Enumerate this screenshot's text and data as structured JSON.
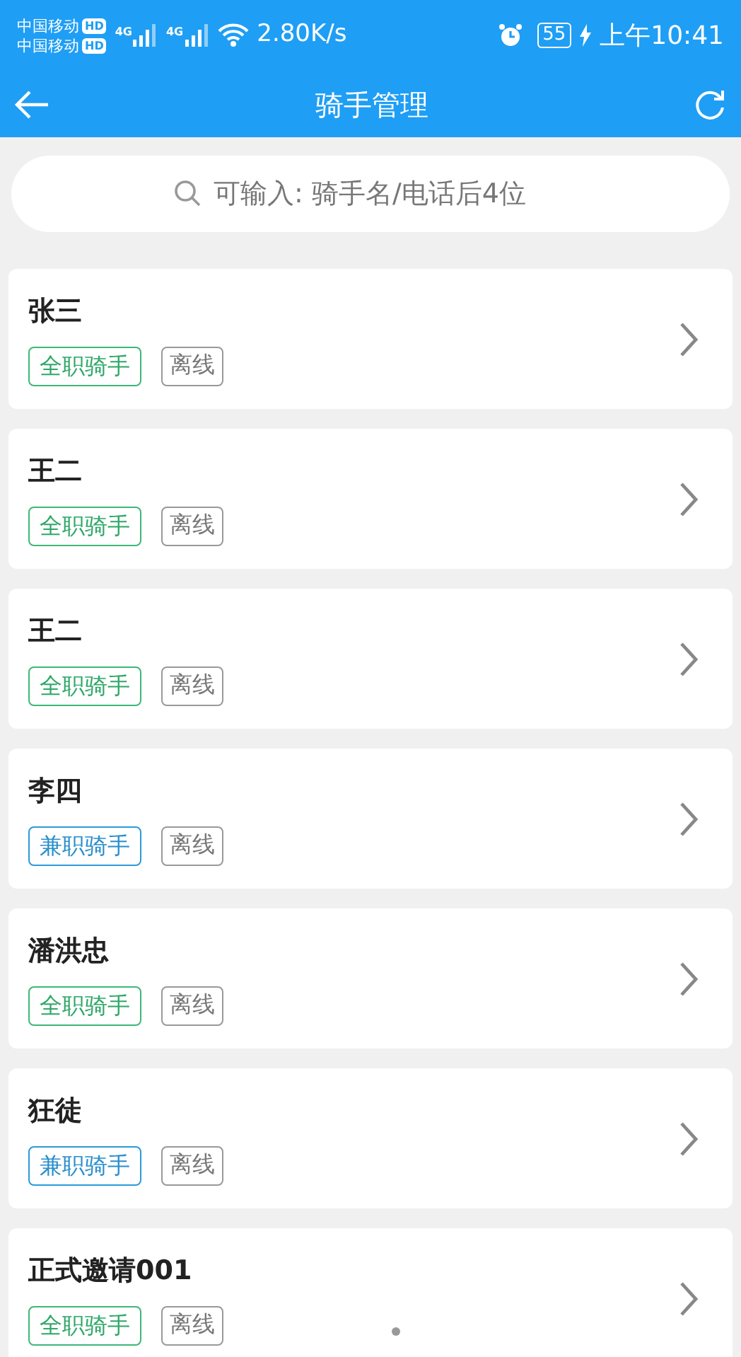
{
  "status_bar": {
    "carriers": [
      "中国移动",
      "中国移动"
    ],
    "hd": [
      "HD",
      "HD"
    ],
    "networks": [
      "4G",
      "4G"
    ],
    "speed": "2.80K/s",
    "battery": "55",
    "time": "上午10:41"
  },
  "header": {
    "title": "骑手管理"
  },
  "search": {
    "placeholder": "可输入: 骑手名/电话后4位"
  },
  "riders": [
    {
      "name": "张三",
      "role": {
        "kind": "fulltime",
        "label": "全职骑手"
      },
      "status": "离线"
    },
    {
      "name": "王二",
      "role": {
        "kind": "fulltime",
        "label": "全职骑手"
      },
      "status": "离线"
    },
    {
      "name": "王二",
      "role": {
        "kind": "fulltime",
        "label": "全职骑手"
      },
      "status": "离线"
    },
    {
      "name": "李四",
      "role": {
        "kind": "parttime",
        "label": "兼职骑手"
      },
      "status": "离线"
    },
    {
      "name": "潘洪忠",
      "role": {
        "kind": "fulltime",
        "label": "全职骑手"
      },
      "status": "离线"
    },
    {
      "name": "狂徒",
      "role": {
        "kind": "parttime",
        "label": "兼职骑手"
      },
      "status": "离线"
    },
    {
      "name": "正式邀请001",
      "role": {
        "kind": "fulltime",
        "label": "全职骑手"
      },
      "status": "离线"
    }
  ]
}
